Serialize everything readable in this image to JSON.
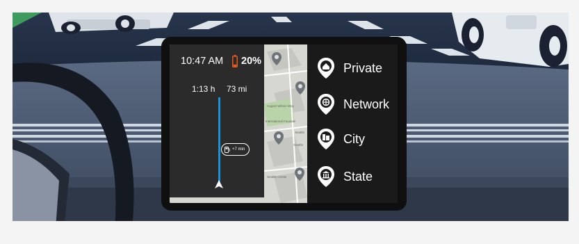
{
  "status": {
    "time": "10:47 AM",
    "battery_percent": "20%",
    "battery_level": 0.2,
    "battery_color": "#e8591e"
  },
  "route": {
    "eta": "1:13 h",
    "distance": "73 mi",
    "stop_delay": "+7 min",
    "route_color": "#1f8fd6"
  },
  "map_labels": [
    "August Wilson Way",
    "International Fountain",
    "Seattle",
    "Seattle",
    "Seattle Center"
  ],
  "menu": {
    "items": [
      {
        "label": "Private",
        "icon": "home-icon"
      },
      {
        "label": "Network",
        "icon": "network-icon"
      },
      {
        "label": "City",
        "icon": "city-buildings-icon"
      },
      {
        "label": "State",
        "icon": "state-building-icon"
      }
    ]
  }
}
